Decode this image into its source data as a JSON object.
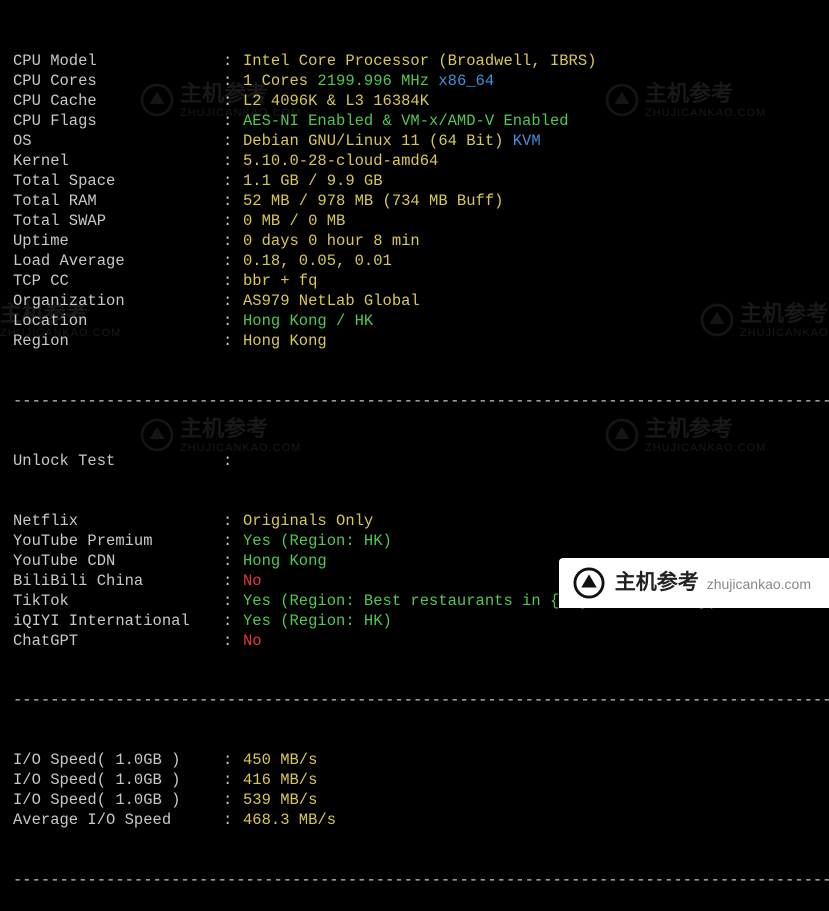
{
  "watermark": {
    "cn": "主机参考",
    "domain": "ZHUJICANKAO.COM"
  },
  "footer": {
    "cn": "主机参考",
    "domain": "zhujicankao.com"
  },
  "divider": "-",
  "sep": ":",
  "sys": [
    {
      "label": "CPU Model",
      "value": "Intel Core Processor (Broadwell, IBRS)",
      "cls": "val-yellow"
    },
    {
      "label": "CPU Cores",
      "parts": [
        {
          "t": "1 Cores ",
          "c": "val-yellow"
        },
        {
          "t": "2199.996 MHz",
          "c": "val-green"
        },
        {
          "t": " x86_64",
          "c": "val-blue"
        }
      ]
    },
    {
      "label": "CPU Cache",
      "value": "L2 4096K & L3 16384K",
      "cls": "val-yellow"
    },
    {
      "label": "CPU Flags",
      "value": "AES-NI Enabled & VM-x/AMD-V Enabled",
      "cls": "val-green"
    },
    {
      "label": "OS",
      "parts": [
        {
          "t": "Debian GNU/Linux 11 (64 Bit)",
          "c": "val-yellow"
        },
        {
          "t": " KVM",
          "c": "val-blue"
        }
      ]
    },
    {
      "label": "Kernel",
      "value": "5.10.0-28-cloud-amd64",
      "cls": "val-yellow"
    },
    {
      "label": "Total Space",
      "value": "1.1 GB / 9.9 GB",
      "cls": "val-yellow"
    },
    {
      "label": "Total RAM",
      "value": "52 MB / 978 MB (734 MB Buff)",
      "cls": "val-yellow"
    },
    {
      "label": "Total SWAP",
      "value": "0 MB / 0 MB",
      "cls": "val-yellow"
    },
    {
      "label": "Uptime",
      "value": "0 days 0 hour 8 min",
      "cls": "val-yellow"
    },
    {
      "label": "Load Average",
      "value": "0.18, 0.05, 0.01",
      "cls": "val-yellow"
    },
    {
      "label": "TCP CC",
      "value": "bbr + fq",
      "cls": "val-yellow"
    },
    {
      "label": "Organization",
      "value": "AS979 NetLab Global",
      "cls": "val-yellow"
    },
    {
      "label": "Location",
      "value": "Hong Kong / HK",
      "cls": "val-green"
    },
    {
      "label": "Region",
      "value": "Hong Kong",
      "cls": "val-yellow"
    }
  ],
  "unlock_header": "Unlock Test",
  "unlock": [
    {
      "label": "Netflix",
      "value": "Originals Only",
      "cls": "val-yellow"
    },
    {
      "label": "YouTube Premium",
      "value": "Yes (Region: HK)",
      "cls": "val-green"
    },
    {
      "label": "YouTube CDN",
      "value": "Hong Kong",
      "cls": "val-green"
    },
    {
      "label": "BiliBili China",
      "value": "No",
      "cls": "val-red"
    },
    {
      "label": "TikTok",
      "value": "Yes (Region: Best restaurants in {regionalPoiName})",
      "cls": "val-green"
    },
    {
      "label": "iQIYI International",
      "value": "Yes (Region: HK)",
      "cls": "val-green"
    },
    {
      "label": "ChatGPT",
      "value": "No",
      "cls": "val-red"
    }
  ],
  "io": [
    {
      "label": "I/O Speed( 1.0GB )",
      "value": "450 MB/s",
      "cls": "val-yellow"
    },
    {
      "label": "I/O Speed( 1.0GB )",
      "value": "416 MB/s",
      "cls": "val-yellow"
    },
    {
      "label": "I/O Speed( 1.0GB )",
      "value": "539 MB/s",
      "cls": "val-yellow"
    },
    {
      "label": "Average I/O Speed",
      "value": "468.3 MB/s",
      "cls": "val-yellow"
    }
  ]
}
